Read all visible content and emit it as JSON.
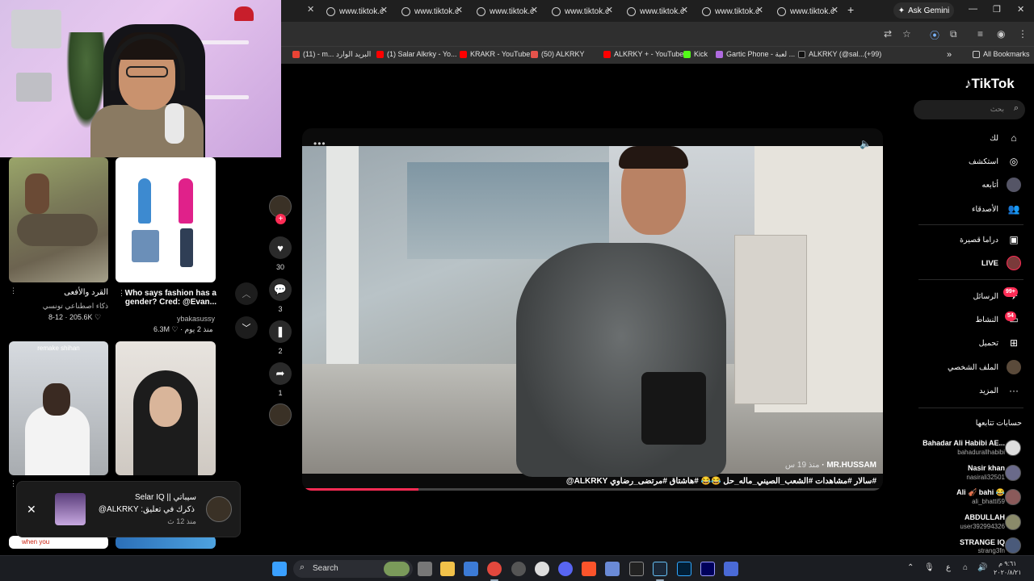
{
  "browser": {
    "tabs": [
      {
        "title": "www.tiktok.c"
      },
      {
        "title": "www.tiktok.c"
      },
      {
        "title": "www.tiktok.c"
      },
      {
        "title": "www.tiktok.c"
      },
      {
        "title": "www.tiktok.c"
      },
      {
        "title": "www.tiktok.c"
      },
      {
        "title": "www.tiktok.c"
      }
    ],
    "ask_gemini": "Ask Gemini",
    "bookmarks": [
      {
        "label": "(11) - m... البريد الوارد"
      },
      {
        "label": "(1) Salar Alkrky - Yo..."
      },
      {
        "label": "KRAKR - YouTube"
      },
      {
        "label": "(50) ALKRKY"
      },
      {
        "label": "ALKRKY + - YouTube"
      },
      {
        "label": "Kick"
      },
      {
        "label": "Gartic Phone - لعبة ..."
      },
      {
        "label": "ALKRKY (@sal...(+99)"
      }
    ],
    "all_bookmarks": "All Bookmarks"
  },
  "feed": {
    "cards": [
      {
        "caption": "القرد والأفعى",
        "author": "ذكاء اصطناعي تونسي",
        "stats": "8-12 · 205.6K ♡"
      },
      {
        "caption_line1": "Who says fashion has a",
        "caption_line2": "gender? Cred: @Evan...",
        "author": "ybakasussy",
        "stats": "6.3M ♡ · منذ 2 يوم"
      },
      {
        "overlay": "remake shihan"
      },
      {}
    ],
    "bottom_peek": "when you"
  },
  "notification": {
    "title": "سيباتي || Selar IQ",
    "body": "ذكرك في تعليق: ALKRKY@",
    "time": "منذ 12 ث"
  },
  "actions": {
    "likes": "30",
    "comments": "3",
    "saves": "2",
    "shares": "1"
  },
  "video": {
    "author": "MR.HUSSAM",
    "ago": "منذ 19 س",
    "caption": "#سالار #مشاهدات #الشعب_الصيني_ماله_حل 😂😂 #هاشتاق #مرتضى_رضاوي ALKRKY@",
    "progress_pct": 20
  },
  "sidebar": {
    "logo": "TikTok",
    "search_placeholder": "بحث",
    "nav": [
      {
        "label": "لك"
      },
      {
        "label": "استكشف"
      },
      {
        "label": "أتابعه"
      },
      {
        "label": "الأصدقاء"
      },
      {
        "label": "دراما قصيرة"
      },
      {
        "label": "LIVE"
      },
      {
        "label": "الرسائل",
        "badge": "99+"
      },
      {
        "label": "النشاط",
        "badge": "54"
      },
      {
        "label": "تحميل"
      },
      {
        "label": "الملف الشخصي"
      },
      {
        "label": "المزيد"
      }
    ],
    "following_title": "حسابات تتابعها",
    "accounts": [
      {
        "name": "Bahadar Ali Habibi AE...",
        "user": "bahadurallhabibi"
      },
      {
        "name": "Nasir khan",
        "user": "nasirali32501"
      },
      {
        "name": "Ali 🎻 bahi 😂",
        "user": "ali_bhatti59"
      },
      {
        "name": "ABDULLAH",
        "user": "user392994326"
      },
      {
        "name": "STRANGE IQ",
        "user": "strang3fn"
      }
    ]
  },
  "taskbar": {
    "search": "Search",
    "lang": "ع",
    "time": "٩:٦١ م",
    "date": "٢٠٢٠/٨/٢١"
  }
}
